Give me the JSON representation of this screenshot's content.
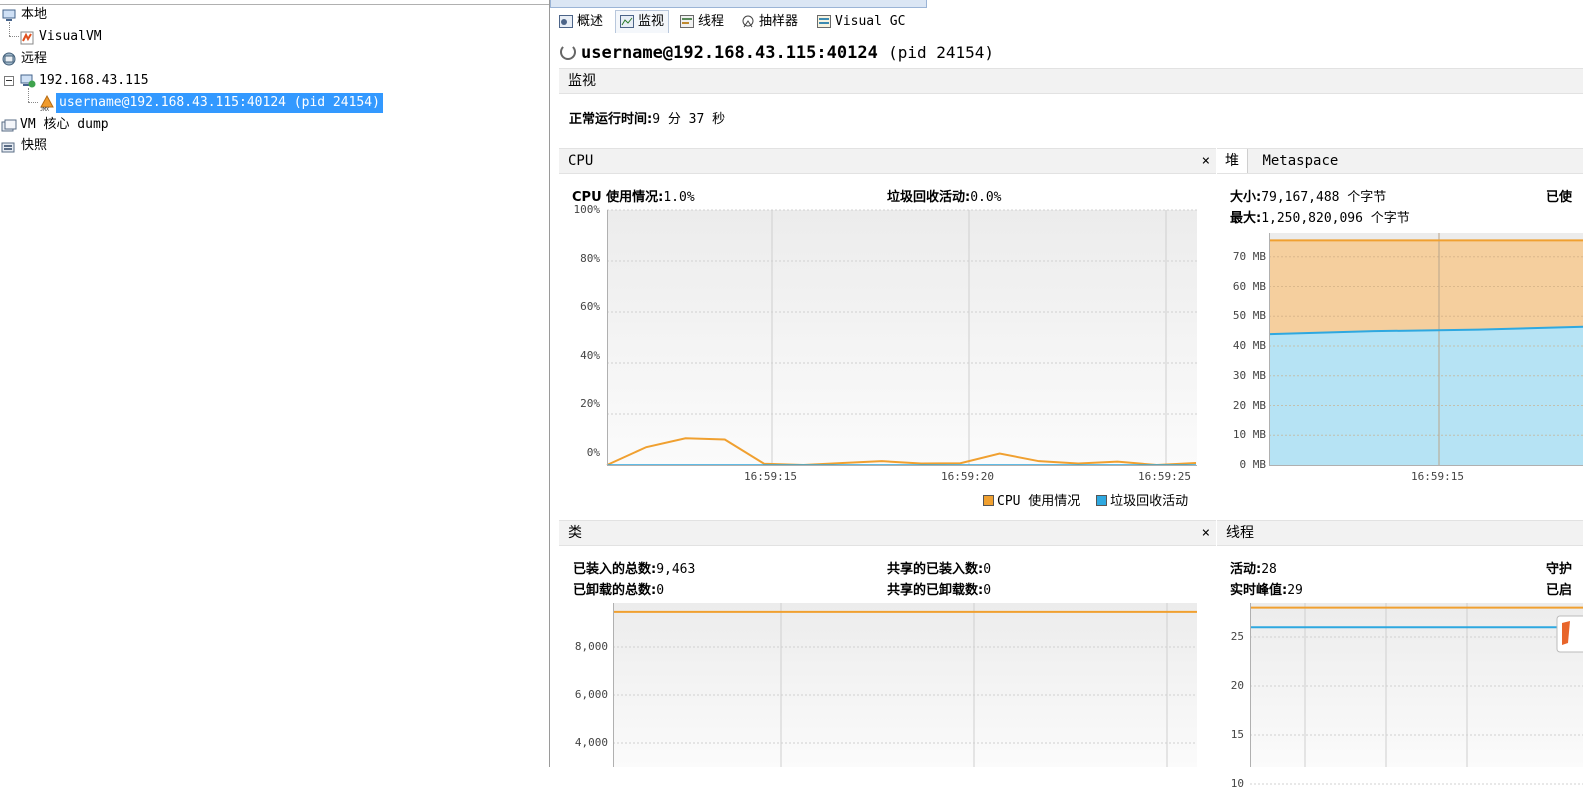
{
  "tree": {
    "local_label": "本地",
    "visualvm_label": "VisualVM",
    "remote_label": "远程",
    "host_label": "192.168.43.115",
    "app_label": "username@192.168.43.115:40124 (pid 24154)",
    "coredump_label": "VM 核心 dump",
    "snapshot_label": "快照"
  },
  "tabs": [
    {
      "label": "概述"
    },
    {
      "label": "监视"
    },
    {
      "label": "线程"
    },
    {
      "label": "抽样器"
    },
    {
      "label": "Visual GC"
    }
  ],
  "header": {
    "title": "username@192.168.43.115:40124",
    "pid": "(pid 24154)",
    "section": "监视",
    "uptime_label": "正常运行时间:",
    "uptime_value": "9 分 37 秒"
  },
  "cpu": {
    "tab": "CPU",
    "close": "×",
    "usage_label": "CPU 使用情况:",
    "usage_value": "1.0%",
    "gc_label": "垃圾回收活动:",
    "gc_value": "0.0%",
    "legend_cpu": "CPU 使用情况",
    "legend_gc": "垃圾回收活动"
  },
  "heap": {
    "tab_heap": "堆",
    "tab_meta": "Metaspace",
    "size_label": "大小:",
    "size_value": "79,167,488 个字节",
    "max_label": "最大:",
    "max_value": "1,250,820,096 个字节",
    "used_label_partial": "已使"
  },
  "classes": {
    "tab": "类",
    "close": "×",
    "loaded_label": "已装入的总数:",
    "loaded_value": "9,463",
    "unloaded_label": "已卸载的总数:",
    "unloaded_value": "0",
    "shared_loaded_label": "共享的已装入数:",
    "shared_loaded_value": "0",
    "shared_unloaded_label": "共享的已卸载数:",
    "shared_unloaded_value": "0"
  },
  "threads": {
    "tab": "线程",
    "live_label": "活动:",
    "live_value": "28",
    "peak_label": "实时峰值:",
    "peak_value": "29",
    "daemon_partial": "守护",
    "started_partial": "已启"
  },
  "colors": {
    "orange": "#f0a030",
    "blue": "#2ea8e0",
    "selection": "#3399ff"
  },
  "chart_data": [
    {
      "type": "line",
      "name": "CPU",
      "series": [
        {
          "name": "CPU 使用情况",
          "color": "#f0a030",
          "values": [
            0,
            7,
            10.5,
            10,
            0.5,
            0,
            0.8,
            1.5,
            0.6,
            0.7,
            4.5,
            1.5,
            0.6,
            1.3,
            0,
            0.8
          ]
        },
        {
          "name": "垃圾回收活动",
          "color": "#2ea8e0",
          "values": [
            0,
            0,
            0,
            0,
            0,
            0,
            0,
            0,
            0,
            0,
            0,
            0,
            0,
            0,
            0,
            0
          ]
        }
      ],
      "y_ticks": [
        "100%",
        "80%",
        "60%",
        "40%",
        "20%",
        "0%"
      ],
      "x_ticks": [
        "16:59:15",
        "16:59:20",
        "16:59:25"
      ],
      "ylim": [
        0,
        100
      ]
    },
    {
      "type": "area",
      "name": "堆",
      "series": [
        {
          "name": "size",
          "color": "#f0a030",
          "values": [
            75.5,
            75.5,
            75.5,
            75.5
          ]
        },
        {
          "name": "used",
          "color": "#2ea8e0",
          "values": [
            44,
            45,
            45.5,
            46.5
          ]
        }
      ],
      "y_ticks": [
        "70 MB",
        "60 MB",
        "50 MB",
        "40 MB",
        "30 MB",
        "20 MB",
        "10 MB",
        "0 MB"
      ],
      "x_ticks": [
        "16:59:15"
      ],
      "ylim": [
        0,
        78
      ]
    },
    {
      "type": "line",
      "name": "类",
      "series": [
        {
          "name": "total",
          "color": "#f0a030",
          "values": [
            9463,
            9463
          ]
        }
      ],
      "y_ticks": [
        "8,000",
        "6,000",
        "4,000"
      ]
    },
    {
      "type": "line",
      "name": "线程",
      "series": [
        {
          "name": "live",
          "color": "#f0a030",
          "values": [
            28,
            28
          ]
        },
        {
          "name": "daemon",
          "color": "#2ea8e0",
          "values": [
            26,
            26
          ]
        }
      ],
      "y_ticks": [
        "25",
        "20",
        "15",
        "10"
      ]
    }
  ]
}
